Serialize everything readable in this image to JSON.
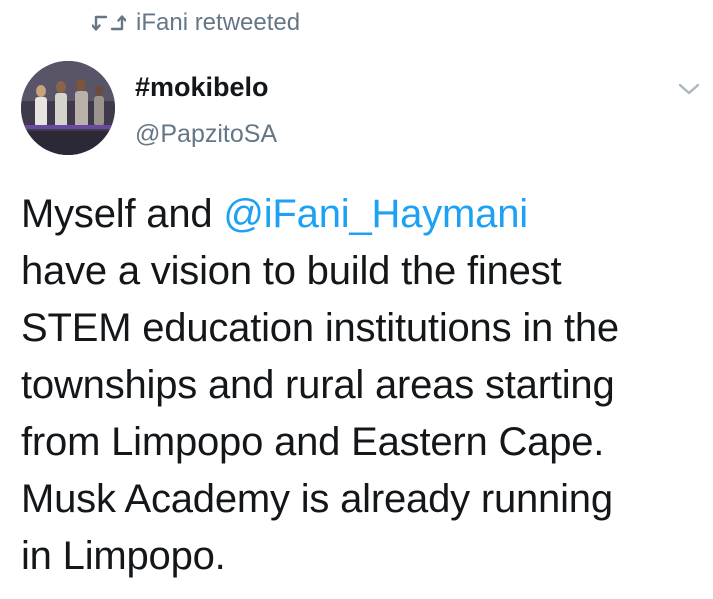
{
  "retweet": {
    "icon": "retweet-icon",
    "label": "iFani retweeted"
  },
  "author": {
    "name": "#mokibelo",
    "handle": "@PapzitoSA",
    "avatar_icon": "avatar-photo"
  },
  "menu": {
    "icon": "chevron-down-icon"
  },
  "tweet": {
    "line1_prefix": "Myself and ",
    "mention": "@iFani_Haymani",
    "line2": "have a vision to build the finest",
    "line3": "STEM education institutions in the",
    "line4": "townships and rural areas starting",
    "line5": "from Limpopo and Eastern Cape.",
    "line6": "Musk Academy is already running",
    "line7": "in Limpopo."
  },
  "colors": {
    "link": "#1da1f2",
    "secondary_text": "#657786",
    "primary_text": "#14171a"
  }
}
